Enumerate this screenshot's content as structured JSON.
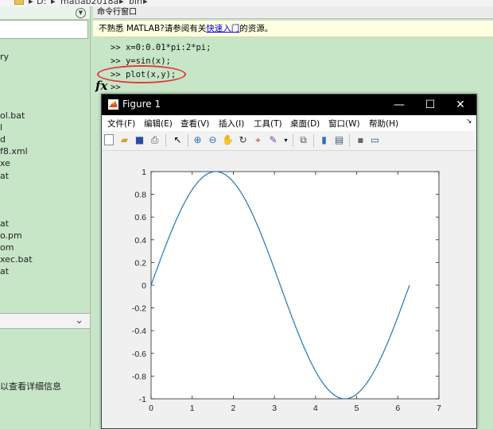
{
  "breadcrumb": {
    "parts": [
      "D:",
      "matlab2018a",
      "bin"
    ],
    "sep": "▸"
  },
  "left_panel": {
    "files": [
      "ry",
      "ol.bat",
      "l",
      "d",
      "f8.xml",
      "xe",
      "at",
      "at",
      "o.pm",
      "om",
      "xec.bat",
      "at"
    ],
    "details_hint": "以查看详细信息"
  },
  "command_window": {
    "title": "命令行窗口",
    "tip_prefix": "不熟悉 MATLAB?请参阅有关",
    "tip_link": "快速入门",
    "tip_suffix": "的资源。",
    "lines": [
      ">> x=0:0.01*pi:2*pi;",
      ">> y=sin(x);",
      ">> plot(x,y);",
      ">>"
    ],
    "prompt_symbol": "fx"
  },
  "figure": {
    "title": "Figure 1",
    "window_buttons": {
      "minimize": "—",
      "maximize": "☐",
      "close": "✕"
    },
    "menus": [
      "文件(F)",
      "编辑(E)",
      "查看(V)",
      "插入(I)",
      "工具(T)",
      "桌面(D)",
      "窗口(W)",
      "帮助(H)"
    ],
    "menu_overflow": "↘",
    "toolbar_icons": [
      "new-figure-icon",
      "open-file-icon",
      "save-icon",
      "print-icon",
      "pointer-icon",
      "zoom-in-icon",
      "zoom-out-icon",
      "pan-icon",
      "rotate-icon",
      "data-cursor-icon",
      "brush-icon",
      "link-icon",
      "colorbar-icon",
      "legend-icon",
      "hide-tools-icon",
      "show-tools-icon"
    ]
  },
  "chart_data": {
    "type": "line",
    "title": "",
    "xlabel": "",
    "ylabel": "",
    "xlim": [
      0,
      7
    ],
    "ylim": [
      -1,
      1
    ],
    "xticks": [
      "0",
      "1",
      "2",
      "3",
      "4",
      "5",
      "6",
      "7"
    ],
    "yticks": [
      "1",
      "0.8",
      "0.6",
      "0.4",
      "0.2",
      "0",
      "-0.2",
      "-0.4",
      "-0.6",
      "-0.8",
      "-1"
    ],
    "series": [
      {
        "function": "y = sin(x)",
        "x_range": [
          0,
          6.2832
        ],
        "step": 0.0314159,
        "color": "#1f77b4"
      }
    ],
    "grid": false
  },
  "colors": {
    "matlab_bg": "#c7e5c7",
    "tip_bg": "#ffffe1",
    "annotation": "#e03a3a",
    "line": "#1f77b4"
  }
}
